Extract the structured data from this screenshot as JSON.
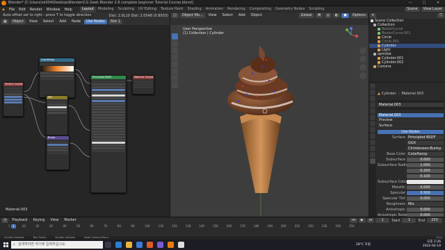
{
  "window": {
    "title": "Blender* [C:\\Users\\sk004\\Desktop\\Blender\\CG Geek Blender 2.8 complete beginner Tutorial Course.blend]",
    "controls": [
      "—",
      "□",
      "✕"
    ]
  },
  "menubar": {
    "items": [
      "File",
      "Edit",
      "Render",
      "Window",
      "Help"
    ],
    "workspaces": [
      "Layout",
      "Modeling",
      "Sculpting",
      "UV Editing",
      "Texture Paint",
      "Shading",
      "Animation",
      "Rendering",
      "Compositing",
      "Geometry Nodes",
      "Scripting"
    ],
    "active_workspace": "Layout",
    "scene_label": "Scene",
    "viewlayer_label": "View Layer"
  },
  "node_editor": {
    "header_status": "Auto-offset set to right - press T to toggle direction",
    "timing": "Dist: 2.0L10  Dist: 2.0548 (0.8503)",
    "menu": [
      "Object",
      "View",
      "Select",
      "Add",
      "Node"
    ],
    "use_nodes": "Use Nodes",
    "slot": "Slot 1",
    "material_label": "Material.003",
    "nodes": {
      "texcoord": "Texture Coordinate",
      "colorramp": "ColorRamp",
      "mix": "Mix",
      "bump": "Bump",
      "bsdf": "Principled BSDF",
      "output": "Material Output"
    }
  },
  "viewport": {
    "mode": "Object Mo...",
    "menu": [
      "View",
      "Select",
      "Add",
      "Object"
    ],
    "orientation": "Global",
    "perspective": "User Perspective",
    "collection": "(1) Collection | Cylinder",
    "options": "Options"
  },
  "outliner": {
    "header": "Scene Collection",
    "items": [
      {
        "label": "Collection",
        "color": "#b0b0b0",
        "dim": false,
        "sel": false
      },
      {
        "label": "BezierCurve",
        "color": "#7fc77f",
        "dim": true,
        "sel": false
      },
      {
        "label": "BezierCurve.001",
        "color": "#7fc77f",
        "dim": true,
        "sel": false
      },
      {
        "label": "Circle",
        "color": "#e0a050",
        "dim": false,
        "sel": false
      },
      {
        "label": "Circle.001",
        "color": "#e0a050",
        "dim": true,
        "sel": false
      },
      {
        "label": "Cylinder",
        "color": "#e0a050",
        "dim": false,
        "sel": true
      },
      {
        "label": "Light",
        "color": "#e0a050",
        "dim": false,
        "sel": false
      },
      {
        "label": "sprinkle",
        "color": "#b0b0b0",
        "dim": false,
        "sel": false
      },
      {
        "label": "Cylinder.001",
        "color": "#e0a050",
        "dim": false,
        "sel": false
      },
      {
        "label": "Cylinder.002",
        "color": "#e0a050",
        "dim": false,
        "sel": false
      },
      {
        "label": "Camera",
        "color": "#e0a050",
        "dim": false,
        "sel": false
      }
    ]
  },
  "properties": {
    "object": "Cylinder",
    "material_tab": "Material.003",
    "slot_material": "Material.003",
    "material_name": "Material.003",
    "sections": {
      "preview": "Preview",
      "surface": "Surface"
    },
    "use_nodes": "Use Nodes",
    "surface_label": "Surface",
    "surface_value": "Principled BSDF",
    "ggx": "GGX",
    "ssm": "Christensen-Burley",
    "rows": [
      {
        "label": "Base Color",
        "value": "ColorRamp",
        "kind": "dark"
      },
      {
        "label": "Subsurface",
        "value": "0.000",
        "kind": ""
      },
      {
        "label": "Subsurface Radius",
        "value": "1.000",
        "kind": ""
      },
      {
        "label": "",
        "value": "0.200",
        "kind": ""
      },
      {
        "label": "",
        "value": "0.100",
        "kind": ""
      },
      {
        "label": "Subsurface Color",
        "value": "",
        "kind": "white"
      },
      {
        "label": "Metallic",
        "value": "0.000",
        "kind": ""
      },
      {
        "label": "Specular",
        "value": "0.500",
        "kind": "blue"
      },
      {
        "label": "Specular Tint",
        "value": "0.000",
        "kind": ""
      },
      {
        "label": "Roughness",
        "value": "Mix",
        "kind": "dark"
      },
      {
        "label": "Anisotropic",
        "value": "0.000",
        "kind": ""
      },
      {
        "label": "Anisotropic Rotat...",
        "value": "0.000",
        "kind": ""
      }
    ]
  },
  "timeline": {
    "menu": [
      "Playback",
      "Keying",
      "View",
      "Marker"
    ],
    "current_frame": "1",
    "start_label": "Start",
    "start": "1",
    "end_label": "End",
    "end": "250",
    "ticks": [
      "1",
      "10",
      "20",
      "30",
      "40",
      "50",
      "60",
      "70",
      "80",
      "90",
      "100",
      "110",
      "120",
      "130",
      "140",
      "150",
      "160",
      "170",
      "180",
      "190",
      "200",
      "210",
      "220",
      "230",
      "240",
      "250"
    ]
  },
  "statusbar": {
    "items": [
      "Scroller Activate",
      "Box Select",
      "Scroller Activate",
      "Node Context Menu"
    ],
    "version": "3.0.0"
  },
  "taskbar": {
    "search_placeholder": "검색하려면 여기에 입력하십시오.",
    "weather": "28°C 흐림",
    "time": "오후 2:26",
    "date": "2022-04-19"
  }
}
